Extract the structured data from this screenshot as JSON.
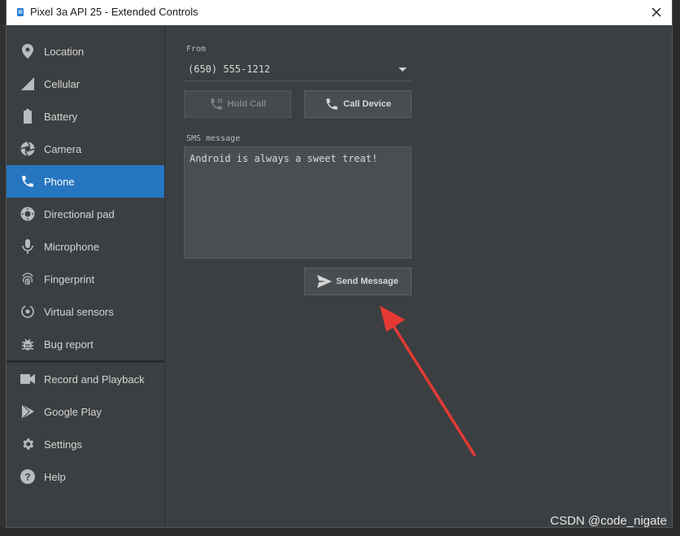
{
  "window": {
    "title": "Pixel 3a API 25 - Extended Controls"
  },
  "sidebar": {
    "items": [
      {
        "label": "Location",
        "icon": "location-pin-icon"
      },
      {
        "label": "Cellular",
        "icon": "signal-icon"
      },
      {
        "label": "Battery",
        "icon": "battery-icon"
      },
      {
        "label": "Camera",
        "icon": "camera-aperture-icon"
      },
      {
        "label": "Phone",
        "icon": "phone-icon",
        "active": true
      },
      {
        "label": "Directional pad",
        "icon": "dpad-icon"
      },
      {
        "label": "Microphone",
        "icon": "microphone-icon"
      },
      {
        "label": "Fingerprint",
        "icon": "fingerprint-icon"
      },
      {
        "label": "Virtual sensors",
        "icon": "rotate-sensor-icon"
      },
      {
        "label": "Bug report",
        "icon": "bug-icon"
      },
      {
        "label": "Record and Playback",
        "icon": "video-camera-icon"
      },
      {
        "label": "Google Play",
        "icon": "play-store-icon"
      },
      {
        "label": "Settings",
        "icon": "gear-icon"
      },
      {
        "label": "Help",
        "icon": "help-icon"
      }
    ]
  },
  "phone": {
    "from_label": "From",
    "from_value": "(650) 555-1212",
    "hold_call_label": "Hold Call",
    "call_device_label": "Call Device",
    "sms_label": "SMS message",
    "sms_value": "Android is always a sweet treat!",
    "send_message_label": "Send Message"
  },
  "watermark": "CSDN @code_nigate",
  "colors": {
    "active": "#2675bf",
    "arrow": "#e53935",
    "panel": "#3c3f41"
  }
}
